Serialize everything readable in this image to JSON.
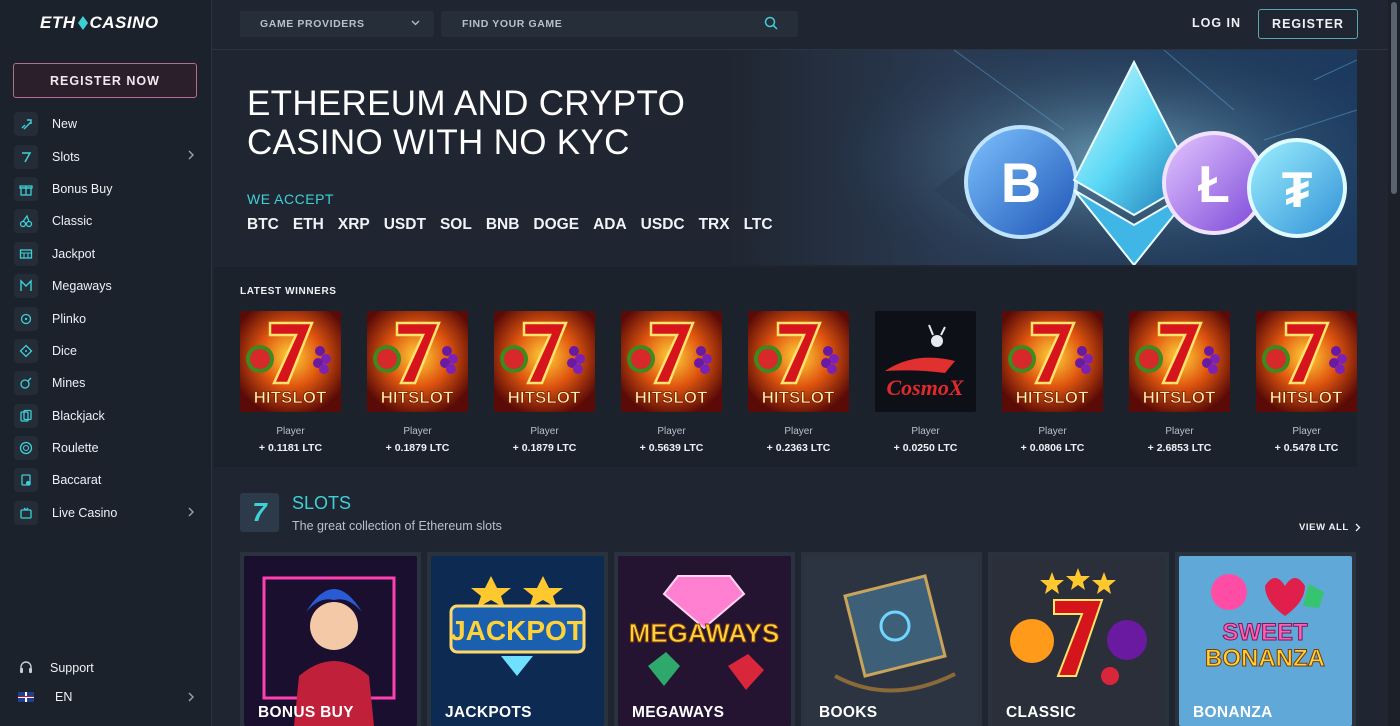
{
  "brand": {
    "logo_left": "ETH",
    "logo_right": "CASINO"
  },
  "sidebar": {
    "register_now": "REGISTER NOW",
    "items": [
      {
        "label": "New",
        "icon": "rocket-icon",
        "has_chevron": false
      },
      {
        "label": "Slots",
        "icon": "slot-seven-icon",
        "has_chevron": true
      },
      {
        "label": "Bonus Buy",
        "icon": "gift-icon",
        "has_chevron": false
      },
      {
        "label": "Classic",
        "icon": "cherry-icon",
        "has_chevron": false
      },
      {
        "label": "Jackpot",
        "icon": "jackpot-icon",
        "has_chevron": false
      },
      {
        "label": "Megaways",
        "icon": "megaways-icon",
        "has_chevron": false
      },
      {
        "label": "Plinko",
        "icon": "plinko-icon",
        "has_chevron": false
      },
      {
        "label": "Dice",
        "icon": "dice-icon",
        "has_chevron": false
      },
      {
        "label": "Mines",
        "icon": "mine-icon",
        "has_chevron": false
      },
      {
        "label": "Blackjack",
        "icon": "cards-icon",
        "has_chevron": false
      },
      {
        "label": "Roulette",
        "icon": "roulette-icon",
        "has_chevron": false
      },
      {
        "label": "Baccarat",
        "icon": "baccarat-icon",
        "has_chevron": false
      },
      {
        "label": "Live Casino",
        "icon": "live-icon",
        "has_chevron": true
      }
    ],
    "support": "Support",
    "language": "EN"
  },
  "topbar": {
    "providers_label": "GAME PROVIDERS",
    "search_placeholder": "FIND YOUR GAME",
    "login": "LOG IN",
    "register": "REGISTER"
  },
  "hero": {
    "title": "ETHEREUM AND CRYPTO CASINO WITH NO KYC",
    "accept_label": "WE ACCEPT",
    "coins": [
      "BTC",
      "ETH",
      "XRP",
      "USDT",
      "SOL",
      "BNB",
      "DOGE",
      "ADA",
      "USDC",
      "TRX",
      "LTC"
    ]
  },
  "winners": {
    "title": "LATEST WINNERS",
    "items": [
      {
        "game": "hitslot",
        "player": "Player",
        "amount": "+ 0.1181 LTC"
      },
      {
        "game": "hitslot",
        "player": "Player",
        "amount": "+ 0.1879 LTC"
      },
      {
        "game": "hitslot",
        "player": "Player",
        "amount": "+ 0.1879 LTC"
      },
      {
        "game": "hitslot",
        "player": "Player",
        "amount": "+ 0.5639 LTC"
      },
      {
        "game": "hitslot",
        "player": "Player",
        "amount": "+ 0.2363 LTC"
      },
      {
        "game": "cosmox",
        "player": "Player",
        "amount": "+ 0.0250 LTC"
      },
      {
        "game": "hitslot",
        "player": "Player",
        "amount": "+ 0.0806 LTC"
      },
      {
        "game": "hitslot",
        "player": "Player",
        "amount": "+ 2.6853 LTC"
      },
      {
        "game": "hitslot",
        "player": "Player",
        "amount": "+ 0.5478 LTC"
      }
    ]
  },
  "slots": {
    "title": "SLOTS",
    "subtitle": "The great collection of Ethereum slots",
    "view_all": "VIEW ALL",
    "categories": [
      {
        "label": "BONUS BUY",
        "art": "joker"
      },
      {
        "label": "JACKPOTS",
        "art": "jackpot"
      },
      {
        "label": "MEGAWAYS",
        "art": "megaways"
      },
      {
        "label": "BOOKS",
        "art": "book"
      },
      {
        "label": "CLASSIC",
        "art": "classic"
      },
      {
        "label": "BONANZA",
        "art": "bonanza"
      }
    ]
  },
  "colors": {
    "accent": "#3fd0d6",
    "register_border": "#b46d8f",
    "bg": "#1f2631"
  }
}
